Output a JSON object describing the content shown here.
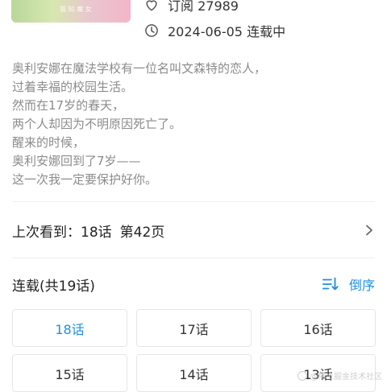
{
  "cover": {
    "caption": "猫 知 魔 女"
  },
  "meta": {
    "subscribe_text": "订阅 27989",
    "date_status": "2024-06-05 连载中"
  },
  "description": "奥利安娜在魔法学校有一位名叫文森特的恋人，\n过着幸福的校园生活。\n然而在17岁的春天，\n两个人却因为不明原因死亡了。\n醒来的时候，\n奥利安娜回到了7岁——\n这一次我一定要保护好你。",
  "last_read": {
    "label": "上次看到：18话",
    "page": "第42页"
  },
  "serial": {
    "title": "连载(共19话)",
    "sort_label": "倒序"
  },
  "episodes": [
    {
      "label": "18话",
      "active": true
    },
    {
      "label": "17话"
    },
    {
      "label": "16话"
    },
    {
      "label": "15话"
    },
    {
      "label": "14话"
    },
    {
      "label": "13话"
    }
  ],
  "watermark": "@稀土掘金技术社区",
  "colors": {
    "accent": "#1e8fe0",
    "muted_text": "#8b8b8b"
  }
}
